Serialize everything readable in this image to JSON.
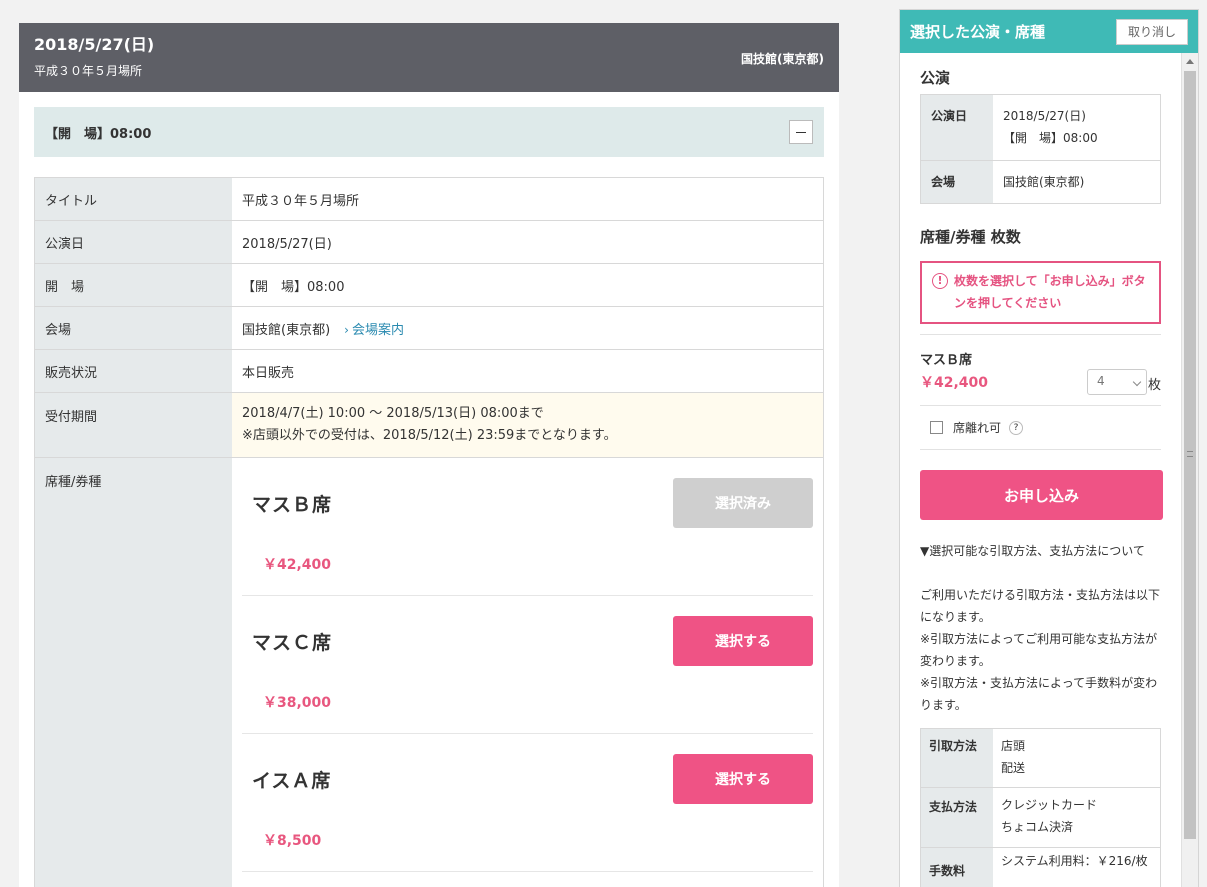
{
  "event": {
    "date": "2018/5/27(日)",
    "subtitle": "平成３０年５月場所",
    "venue": "国技館(東京都)"
  },
  "open_bar": {
    "label": "【開　場】08:00"
  },
  "info": {
    "rows": [
      {
        "key": "タイトル",
        "value": "平成３０年５月場所"
      },
      {
        "key": "公演日",
        "value": "2018/5/27(日)"
      },
      {
        "key": "開　場",
        "value": "【開　場】08:00"
      },
      {
        "key": "会場",
        "value": "国技館(東京都)",
        "link": "会場案内"
      },
      {
        "key": "販売状況",
        "value": "本日販売"
      }
    ],
    "period": {
      "key": "受付期間",
      "line1": "2018/4/7(土) 10:00 ～ 2018/5/13(日) 08:00まで",
      "line2": "※店頭以外での受付は、2018/5/12(土) 23:59までとなります。"
    },
    "seats_key": "席種/券種",
    "seats": [
      {
        "name": "マスＢ席",
        "price": "￥42,400",
        "button": "選択済み"
      },
      {
        "name": "マスＣ席",
        "price": "￥38,000",
        "button": "選択する"
      },
      {
        "name": "イスＡ席",
        "price": "￥8,500",
        "button": "選択する"
      }
    ]
  },
  "sidebar": {
    "title": "選択した公演・席種",
    "cancel": "取り消し",
    "perf_title": "公演",
    "perf": {
      "date_key": "公演日",
      "date": "2018/5/27(日)",
      "open": "【開　場】08:00",
      "venue_key": "会場",
      "venue": "国技館(東京都)"
    },
    "seat_title": "席種/券種 枚数",
    "warning": "枚数を選択して「お申し込み」ボタンを押してください",
    "selected": {
      "name": "マスＢ席",
      "price": "￥42,400",
      "qty": "4",
      "unit": "枚"
    },
    "separate_label": "席離れ可",
    "apply": "お申し込み",
    "note_head": "▼選択可能な引取方法、支払方法について",
    "note_lines": [
      "ご利用いただける引取方法・支払方法は以下になります。",
      "※引取方法によってご利用可能な支払方法が変わります。",
      "※引取方法・支払方法によって手数料が変わります。"
    ],
    "methods": {
      "pickup_key": "引取方法",
      "pickup": [
        "店頭",
        "配送"
      ],
      "payment_key": "支払方法",
      "payment": [
        "クレジットカード",
        "ちょコム決済"
      ],
      "fee_key": "手数料",
      "fee": "システム利用料：￥216/枚"
    }
  }
}
